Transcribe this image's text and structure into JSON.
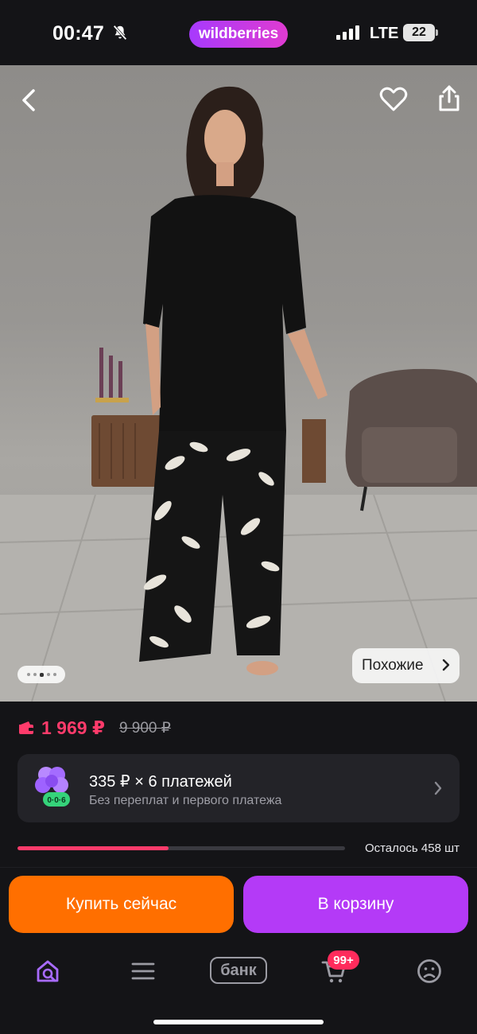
{
  "status_bar": {
    "time": "00:47",
    "brand": "wildberries",
    "network": "LTE",
    "battery": "22"
  },
  "gallery": {
    "similar_label": "Похожие",
    "pages": 5,
    "active_page": 3
  },
  "price": {
    "current": "1 969 ₽",
    "old": "9 900 ₽"
  },
  "installment": {
    "title": "335 ₽ × 6 платежей",
    "subtitle": "Без переплат и первого платежа",
    "badge": "0·0·6"
  },
  "stock": {
    "label": "Осталось 458 шт",
    "fill_fraction": 0.46
  },
  "actions": {
    "buy_label": "Купить сейчас",
    "cart_label": "В корзину"
  },
  "tabbar": {
    "bank_label": "банк",
    "cart_badge": "99+"
  },
  "colors": {
    "accent_purple": "#b43af7",
    "buy_orange": "#ff6f00",
    "price_pink": "#ff3b6b"
  }
}
